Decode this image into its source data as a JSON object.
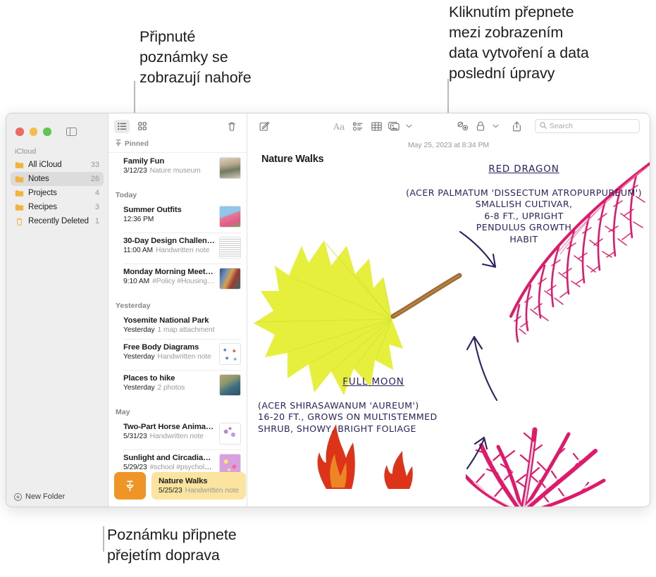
{
  "callouts": {
    "pinned": "Připnuté\npoznámky se\nzobrazují nahoře",
    "date_toggle": "Kliknutím přepnete\nmezi zobrazením\ndata vytvoření a data\nposlední úpravy",
    "swipe_pin": "Poznámku připnete\npřejetím doprava"
  },
  "sidebar": {
    "section_title": "iCloud",
    "items": [
      {
        "label": "All iCloud",
        "count": "33",
        "icon": "folder-icon",
        "selected": false
      },
      {
        "label": "Notes",
        "count": "26",
        "icon": "folder-icon",
        "selected": true
      },
      {
        "label": "Projects",
        "count": "4",
        "icon": "folder-icon",
        "selected": false
      },
      {
        "label": "Recipes",
        "count": "3",
        "icon": "folder-icon",
        "selected": false
      },
      {
        "label": "Recently Deleted",
        "count": "1",
        "icon": "trash-icon",
        "selected": false
      }
    ],
    "new_folder_label": "New Folder"
  },
  "notes_list": {
    "toolbar": {
      "list_view_icon": "list-view-icon",
      "gallery_view_icon": "gallery-view-icon",
      "delete_icon": "trash-icon"
    },
    "pinned_header": "Pinned",
    "pinned_icon": "pin-icon",
    "groups": [
      {
        "label": "",
        "notes": [
          {
            "title": "Family Fun",
            "date": "3/12/23",
            "meta": "Nature museum",
            "thumb": "photo-museum"
          }
        ]
      },
      {
        "label": "Today",
        "notes": [
          {
            "title": "Summer Outfits",
            "date": "12:36 PM",
            "meta": "",
            "thumb": "photo-dress"
          },
          {
            "title": "30-Day Design Challen…",
            "date": "11:00 AM",
            "meta": "Handwritten note",
            "thumb": "doc-sketch"
          },
          {
            "title": "Monday Morning Meeting",
            "date": "9:10 AM",
            "meta": "#Policy #Housing…",
            "thumb": "photo-meeting"
          }
        ]
      },
      {
        "label": "Yesterday",
        "notes": [
          {
            "title": "Yosemite National Park",
            "date": "Yesterday",
            "meta": "1 map attachment",
            "thumb": ""
          },
          {
            "title": "Free Body Diagrams",
            "date": "Yesterday",
            "meta": "Handwritten note",
            "thumb": "doc-diagram"
          },
          {
            "title": "Places to hike",
            "date": "Yesterday",
            "meta": "2 photos",
            "thumb": "photo-coast"
          }
        ]
      },
      {
        "label": "May",
        "notes": [
          {
            "title": "Two-Part Horse Anima…",
            "date": "5/31/23",
            "meta": "Handwritten note",
            "thumb": "doc-scribble"
          },
          {
            "title": "Sunlight and Circadian…",
            "date": "5/29/23",
            "meta": "#school #psycholo…",
            "thumb": "photo-neuron"
          }
        ]
      }
    ],
    "selected_note": {
      "title": "Nature Walks",
      "date": "5/25/23",
      "meta": "Handwritten note",
      "pin_action_icon": "pin-icon"
    }
  },
  "editor": {
    "toolbar": {
      "compose_icon": "compose-icon",
      "format_icon": "format-aa-icon",
      "checklist_icon": "checklist-icon",
      "table_icon": "table-icon",
      "media_icon": "media-icon",
      "media_chevron_icon": "chevron-down-icon",
      "collaborate_icon": "collaborate-icon",
      "lock_icon": "lock-icon",
      "lock_chevron_icon": "chevron-down-icon",
      "share_icon": "share-icon",
      "search_icon": "search-icon",
      "search_placeholder": "Search",
      "search_value": ""
    },
    "note_date": "May 25, 2023 at 8:34 PM",
    "note_title": "Nature Walks",
    "handwriting": {
      "red_dragon_heading": "RED DRAGON",
      "red_dragon_body": "(ACER PALMATUM 'DISSECTUM ATROPURPUREUM')\nSMALLISH CULTIVAR,\n6-8 FT., UPRIGHT\nPENDULUS GROWTH\nHABIT",
      "full_moon_heading": "FULL MOON",
      "full_moon_body": "(ACER SHIRASAWANUM 'AUREUM')\n16-20 FT., GROWS ON MULTISTEMMED\nSHRUB, SHOWY, BRIGHT FOLIAGE"
    }
  },
  "colors": {
    "pin_orange": "#ef9427",
    "selected_yellow": "#fbe3a0",
    "folder_yellow": "#f0b53e",
    "ink_purple": "#2c2160",
    "leaf_yellow": "#e6f03c",
    "leaf_magenta": "#e01a6b",
    "leaf_red": "#dd3318"
  }
}
